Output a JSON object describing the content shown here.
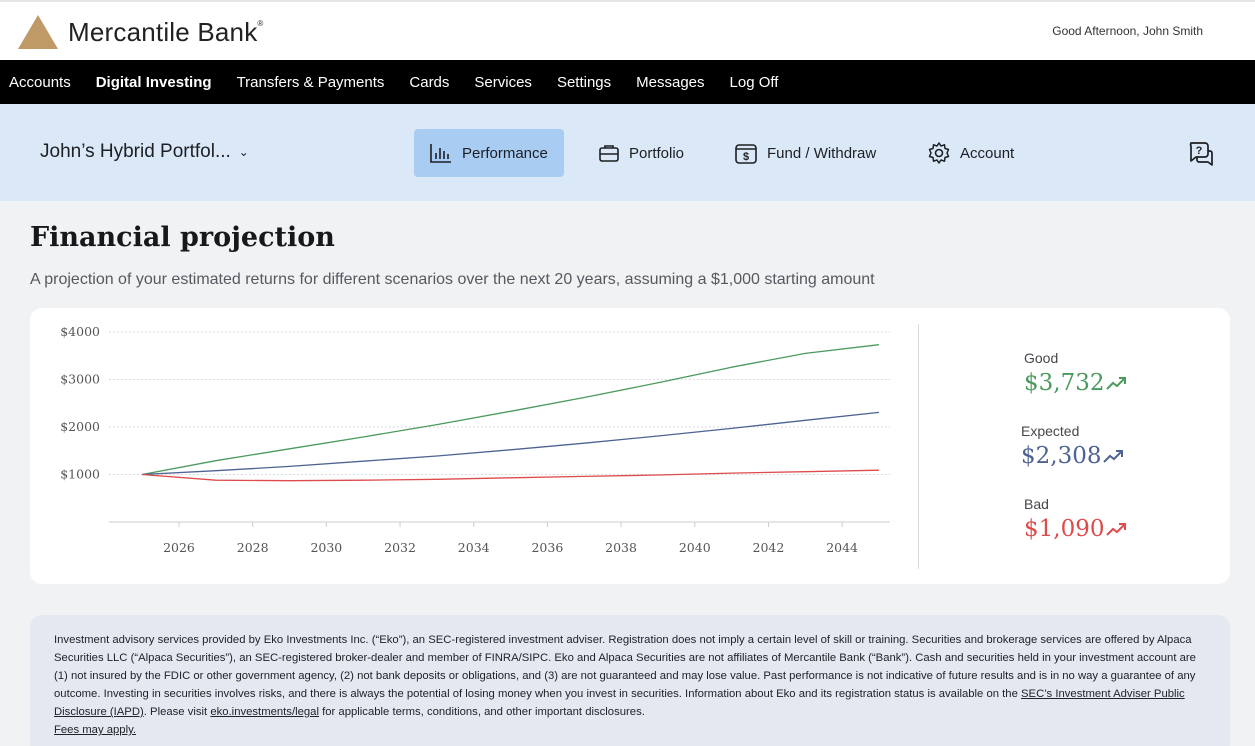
{
  "brand": {
    "name": "Mercantile Bank",
    "reg": "®",
    "accent": "#bf9a66"
  },
  "greeting": "Good Afternoon, John Smith",
  "nav": [
    {
      "label": "Accounts"
    },
    {
      "label": "Digital Investing"
    },
    {
      "label": "Transfers & Payments"
    },
    {
      "label": "Cards"
    },
    {
      "label": "Services"
    },
    {
      "label": "Settings"
    },
    {
      "label": "Messages"
    },
    {
      "label": "Log Off"
    }
  ],
  "portfolio": {
    "name": "John’s Hybrid Portfol...",
    "chevron": "⌄"
  },
  "tabs": [
    {
      "label": "Performance",
      "icon": "bar-chart-icon",
      "active": true
    },
    {
      "label": "Portfolio",
      "icon": "briefcase-icon"
    },
    {
      "label": "Fund / Withdraw",
      "icon": "dollar-box-icon"
    },
    {
      "label": "Account",
      "icon": "gear-icon"
    }
  ],
  "page": {
    "title": "Financial projection",
    "subtitle": "A projection of your estimated returns for different scenarios over the next 20 years, assuming a $1,000 starting amount"
  },
  "scenarios": [
    {
      "label": "Good",
      "value": "$3,732",
      "color": "#4a9a5e"
    },
    {
      "label": "Expected",
      "value": "$2,308",
      "color": "#4d6392"
    },
    {
      "label": "Bad",
      "value": "$1,090",
      "color": "#de4b4b"
    }
  ],
  "chart_data": {
    "type": "line",
    "y_tick_labels": [
      "$4000",
      "$3000",
      "$2000",
      "$1000"
    ],
    "y_ticks": [
      4000,
      3000,
      2000,
      1000
    ],
    "x_tick_labels": [
      "2026",
      "2028",
      "2030",
      "2032",
      "2034",
      "2036",
      "2038",
      "2040",
      "2042",
      "2044"
    ],
    "x_ticks": [
      2026,
      2028,
      2030,
      2032,
      2034,
      2036,
      2038,
      2040,
      2042,
      2044
    ],
    "xlim": [
      2024,
      2045
    ],
    "ylim": [
      0,
      4000
    ],
    "grid": true,
    "series": [
      {
        "name": "Good",
        "color": "#4a9a5e",
        "x": [
          2025,
          2027,
          2029,
          2031,
          2033,
          2035,
          2037,
          2039,
          2041,
          2043,
          2045
        ],
        "y": [
          1000,
          1290,
          1540,
          1790,
          2050,
          2330,
          2620,
          2930,
          3260,
          3550,
          3732
        ]
      },
      {
        "name": "Expected",
        "color": "#4d6392",
        "x": [
          2025,
          2027,
          2029,
          2031,
          2033,
          2035,
          2037,
          2039,
          2041,
          2043,
          2045
        ],
        "y": [
          1000,
          1080,
          1170,
          1280,
          1390,
          1520,
          1660,
          1810,
          1970,
          2140,
          2308
        ]
      },
      {
        "name": "Bad",
        "color": "#de4b4b",
        "x": [
          2025,
          2027,
          2029,
          2031,
          2033,
          2035,
          2037,
          2039,
          2041,
          2043,
          2045
        ],
        "y": [
          1000,
          880,
          870,
          880,
          900,
          930,
          960,
          990,
          1030,
          1060,
          1090
        ]
      }
    ]
  },
  "disclosure": {
    "p1": "Investment advisory services provided by Eko Investments Inc. (“Eko”), an SEC-registered investment adviser. Registration does not imply a certain level of skill or training. Securities and brokerage services are offered by Alpaca Securities LLC (“Alpaca Securities”), an SEC-registered broker-dealer and member of FINRA/SIPC. Eko and Alpaca Securities are not affiliates of Mercantile Bank (“Bank”). Cash and securities held in your investment account are (1) not insured by the FDIC or other government agency, (2) not bank deposits or obligations, and (3) are not guaranteed and may lose value. Past performance is not indicative of future results and is in no way a guarantee of any outcome. Investing in securities involves risks, and there is always the potential of losing money when you invest in securities. Information about Eko and its registration status is available on the ",
    "link1": "SEC’s Investment Adviser Public Disclosure (IAPD)",
    "p2": ". Please visit ",
    "link2": "eko.investments/legal",
    "p3": " for applicable terms, conditions, and other important disclosures.",
    "link3": "Fees may apply."
  }
}
